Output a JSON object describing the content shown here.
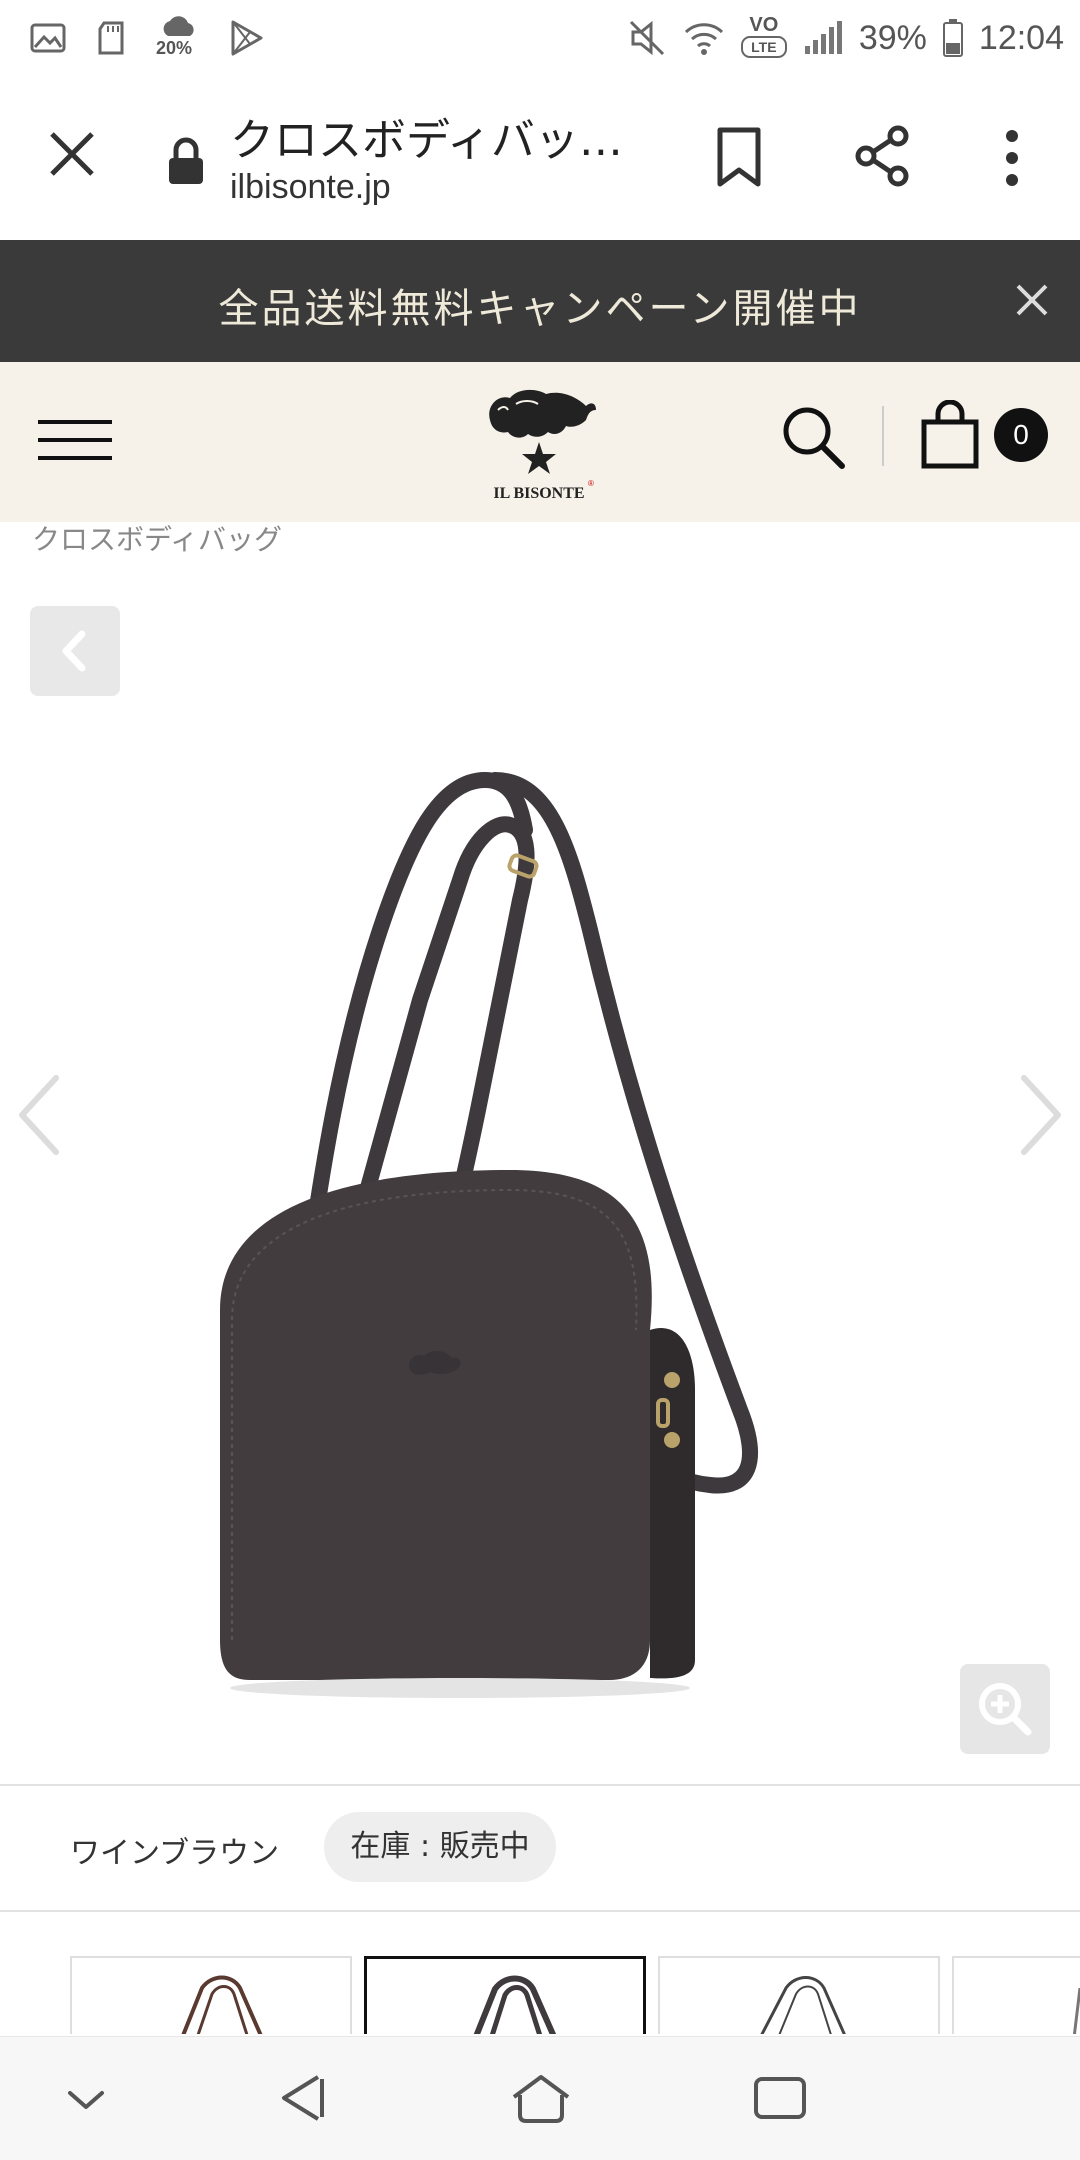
{
  "status_bar": {
    "left_icons": [
      "gallery-icon",
      "sd-card-icon",
      "weather-icon",
      "play-store-icon"
    ],
    "weather_percent": "20%",
    "right_icons": [
      "mute-icon",
      "wifi-icon",
      "volte-icon",
      "signal-icon",
      "battery-icon"
    ],
    "volte_top": "VO",
    "volte_bottom": "LTE",
    "battery": "39%",
    "time": "12:04"
  },
  "browser": {
    "title": "クロスボディバッ…",
    "url": "ilbisonte.jp",
    "icons": {
      "close": "close-icon",
      "lock": "lock-icon",
      "bookmark": "bookmark-icon",
      "share": "share-icon",
      "menu": "more-vert-icon"
    }
  },
  "banner": {
    "text": "全品送料無料キャンペーン開催中",
    "close_icon": "close-icon"
  },
  "site_header": {
    "logo_text": "IL BISONTE",
    "cart_count": "0",
    "background": "#f6f2ea",
    "icons": {
      "menu": "hamburger-icon",
      "search": "search-icon",
      "cart": "shopping-bag-icon"
    }
  },
  "breadcrumb": "クロスボディバッグ",
  "gallery": {
    "icons": {
      "back": "chevron-left-icon",
      "prev": "chevron-left-icon",
      "next": "chevron-right-icon",
      "zoom": "zoom-in-icon"
    },
    "product_color": "#3f3a3d"
  },
  "variant": {
    "color_name": "ワインブラウン",
    "stock_status": "在庫 : 販売中"
  },
  "thumbnails": [
    {
      "color": "#5a3a30",
      "selected": false
    },
    {
      "color": "#3f3a3d",
      "selected": true
    },
    {
      "color": "#444444",
      "selected": false
    },
    {
      "color": "#777777",
      "selected": false
    }
  ],
  "nav_bar": {
    "icons": [
      "chevron-down-icon",
      "back-icon",
      "home-icon",
      "recent-apps-icon"
    ]
  }
}
